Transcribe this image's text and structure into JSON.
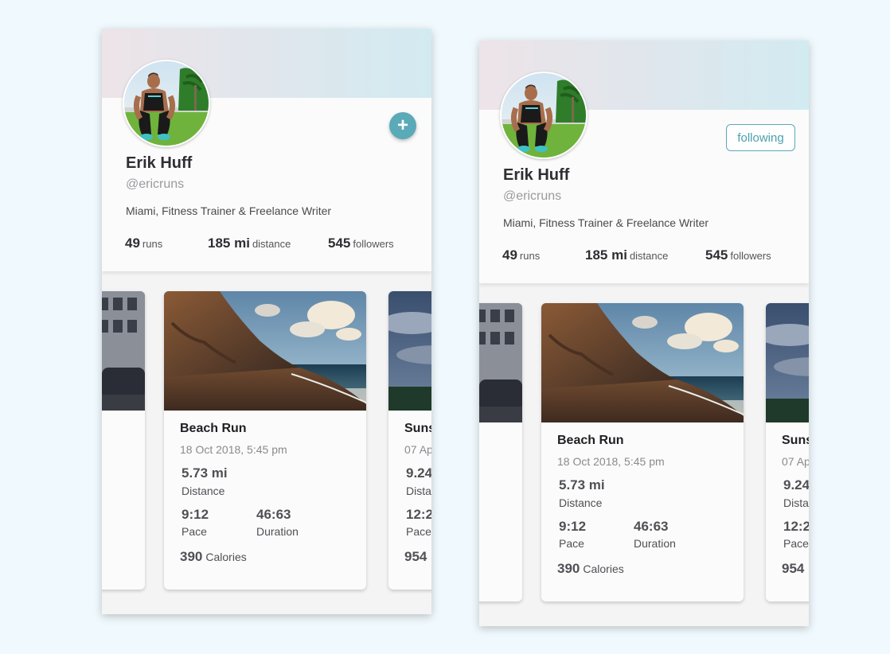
{
  "colors": {
    "page_bg": "#f0f9fd",
    "accent": "#5aaab8",
    "card_bg": "#fbfbfb",
    "text_dark": "#2e2e33",
    "text_muted": "#9a9a9e"
  },
  "icons": {
    "add": "plus-icon"
  },
  "screens": [
    {
      "profile": {
        "name": "Erik Huff",
        "handle": "@ericruns",
        "bio": "Miami, Fitness Trainer & Freelance Writer",
        "action_symbol": "+",
        "stats": [
          {
            "value": "49",
            "label": "runs"
          },
          {
            "value": "185 mi",
            "label": "distance"
          },
          {
            "value": "545",
            "label": "followers"
          }
        ]
      },
      "cards": [
        {
          "title": "",
          "date": "",
          "distance": "",
          "distance_label": "",
          "pace": "",
          "pace_label": "",
          "duration": "",
          "duration_label": "",
          "calories": "",
          "calories_label": ""
        },
        {
          "title": "Beach Run",
          "date": "18 Oct 2018, 5:45 pm",
          "distance": "5.73 mi",
          "distance_label": "Distance",
          "pace": "9:12",
          "pace_label": "Pace",
          "duration": "46:63",
          "duration_label": "Duration",
          "calories": "390",
          "calories_label": "Calories"
        },
        {
          "title": "Suns",
          "date": "07 Ap",
          "distance": "9.24",
          "distance_label": "Dista",
          "pace": "12:2",
          "pace_label": "Pace",
          "duration": "",
          "duration_label": "",
          "calories": "954",
          "calories_label": ""
        }
      ]
    },
    {
      "profile": {
        "name": "Erik Huff",
        "handle": "@ericruns",
        "bio": "Miami, Fitness Trainer & Freelance Writer",
        "action_label": "following",
        "stats": [
          {
            "value": "49",
            "label": "runs"
          },
          {
            "value": "185 mi",
            "label": "distance"
          },
          {
            "value": "545",
            "label": "followers"
          }
        ]
      },
      "cards": [
        {
          "title": "",
          "date": "",
          "distance": "",
          "distance_label": "",
          "pace": "",
          "pace_label": "",
          "duration": "",
          "duration_label": "",
          "calories": "",
          "calories_label": ""
        },
        {
          "title": "Beach Run",
          "date": "18 Oct 2018, 5:45 pm",
          "distance": "5.73 mi",
          "distance_label": "Distance",
          "pace": "9:12",
          "pace_label": "Pace",
          "duration": "46:63",
          "duration_label": "Duration",
          "calories": "390",
          "calories_label": "Calories"
        },
        {
          "title": "Suns",
          "date": "07 Ap",
          "distance": "9.24",
          "distance_label": "Dista",
          "pace": "12:2",
          "pace_label": "Pace",
          "duration": "",
          "duration_label": "",
          "calories": "954",
          "calories_label": ""
        }
      ]
    }
  ]
}
